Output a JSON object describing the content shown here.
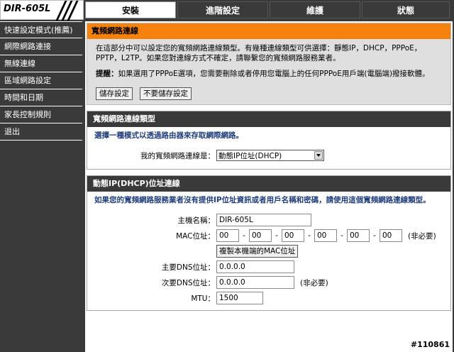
{
  "logo": "DIR-605L",
  "tabs": [
    "安裝",
    "進階設定",
    "維護",
    "狀態"
  ],
  "sidebar": {
    "items": [
      "快速設定模式(推薦)",
      "網際網路連接",
      "無線連線",
      "區域網路設定",
      "時間和日期",
      "家長控制規則",
      "退出"
    ]
  },
  "notice": {
    "title": "寬頻網路連線",
    "text": "在這部分中可以設定您的寬頻網路連線類型。有幾種連線類型可供選擇：靜態IP，DHCP，PPPoE，PPTP，L2TP。如果您對連線方式不確定，請聯繫您的寬頻網路服務業者。",
    "tip_label": "提醒：",
    "tip_text": "如果選用了PPPoE選項，您需要刪除或者停用您電腦上的任何PPPoE用戶端(電腦端)撥接軟體。",
    "save_label": "儲存設定",
    "dont_save_label": "不要儲存設定"
  },
  "conn_type": {
    "title": "寬頻網路連線類型",
    "desc": "選擇一種模式以透過路由器來存取網際網路。",
    "label": "我的寬頻網路連線是：",
    "selected": "動態IP位址(DHCP)"
  },
  "dhcp": {
    "title": "動態IP(DHCP)位址連線",
    "desc": "如果您的寬頻網路服務業者沒有提供IP位址資訊或者用戶名稱和密碼，請使用這個寬頻網路連線類型。",
    "host_label": "主機名稱：",
    "host_value": "DIR-605L",
    "mac_label": "MAC位址：",
    "mac_values": [
      "00",
      "00",
      "00",
      "00",
      "00",
      "00"
    ],
    "mac_sep": "-",
    "optional": "(非必要)",
    "clone_label": "複製本機端的MAC位址",
    "dns1_label": "主要DNS位址：",
    "dns1_value": "0.0.0.0",
    "dns2_label": "次要DNS位址：",
    "dns2_value": "0.0.0.0",
    "mtu_label": "MTU：",
    "mtu_value": "1500"
  },
  "watermark": "#110861"
}
